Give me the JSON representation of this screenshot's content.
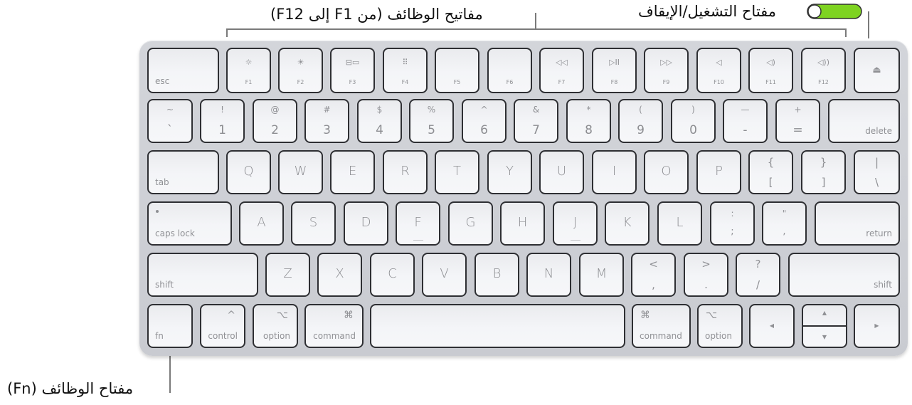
{
  "callouts": {
    "function_keys": "مفاتيح الوظائف (من F1 إلى F12)",
    "power_key": "مفتاح التشغيل/الإيقاف",
    "fn_key": "مفتاح الوظائف (Fn)"
  },
  "colors": {
    "toggle_on": "#7ed321",
    "key_border": "#2e2f33",
    "body": "#cfd1d6"
  },
  "keys": {
    "row1": {
      "esc": "esc",
      "f1": {
        "label": "F1",
        "icon": "brightness-down-icon",
        "glyph": "☼"
      },
      "f2": {
        "label": "F2",
        "icon": "brightness-up-icon",
        "glyph": "☀"
      },
      "f3": {
        "label": "F3",
        "icon": "mission-control-icon",
        "glyph": "⊟▭"
      },
      "f4": {
        "label": "F4",
        "icon": "launchpad-icon",
        "glyph": "⠿"
      },
      "f5": {
        "label": "F5"
      },
      "f6": {
        "label": "F6"
      },
      "f7": {
        "label": "F7",
        "icon": "rewind-icon",
        "glyph": "◁◁"
      },
      "f8": {
        "label": "F8",
        "icon": "play-pause-icon",
        "glyph": "▷II"
      },
      "f9": {
        "label": "F9",
        "icon": "fast-forward-icon",
        "glyph": "▷▷"
      },
      "f10": {
        "label": "F10",
        "icon": "mute-icon",
        "glyph": "◁"
      },
      "f11": {
        "label": "F11",
        "icon": "volume-down-icon",
        "glyph": "◁)"
      },
      "f12": {
        "label": "F12",
        "icon": "volume-up-icon",
        "glyph": "◁))"
      },
      "eject": "⏏"
    },
    "row2": [
      {
        "up": "~",
        "dn": "`"
      },
      {
        "up": "!",
        "dn": "1"
      },
      {
        "up": "@",
        "dn": "2"
      },
      {
        "up": "#",
        "dn": "3"
      },
      {
        "up": "$",
        "dn": "4"
      },
      {
        "up": "%",
        "dn": "5"
      },
      {
        "up": "^",
        "dn": "6"
      },
      {
        "up": "&",
        "dn": "7"
      },
      {
        "up": "*",
        "dn": "8"
      },
      {
        "up": "(",
        "dn": "9"
      },
      {
        "up": ")",
        "dn": "0"
      },
      {
        "up": "—",
        "dn": "-"
      },
      {
        "up": "+",
        "dn": "="
      }
    ],
    "delete": "delete",
    "tab": "tab",
    "row3": [
      "Q",
      "W",
      "E",
      "R",
      "T",
      "Y",
      "U",
      "I",
      "O",
      "P"
    ],
    "row3_sym": [
      {
        "up": "{",
        "dn": "["
      },
      {
        "up": "}",
        "dn": "]"
      },
      {
        "up": "|",
        "dn": "\\"
      }
    ],
    "caps_lock": "caps lock",
    "row4": [
      "A",
      "S",
      "D",
      "F",
      "G",
      "H",
      "J",
      "K",
      "L"
    ],
    "row4_sym": [
      {
        "up": ":",
        "dn": ";"
      },
      {
        "up": "\"",
        "dn": ","
      }
    ],
    "return": "return",
    "shift": "shift",
    "row5": [
      "Z",
      "X",
      "C",
      "V",
      "B",
      "N",
      "M"
    ],
    "row5_sym": [
      {
        "up": "<",
        "dn": ","
      },
      {
        "up": ">",
        "dn": "."
      },
      {
        "up": "?",
        "dn": "/"
      }
    ],
    "fn": "fn",
    "control": {
      "label": "control",
      "glyph": "^"
    },
    "option": {
      "label": "option",
      "glyph": "⌥"
    },
    "command": {
      "label": "command",
      "glyph": "⌘"
    },
    "arrows": {
      "left": "◀",
      "up": "▲",
      "down": "▼",
      "right": "▶"
    }
  }
}
